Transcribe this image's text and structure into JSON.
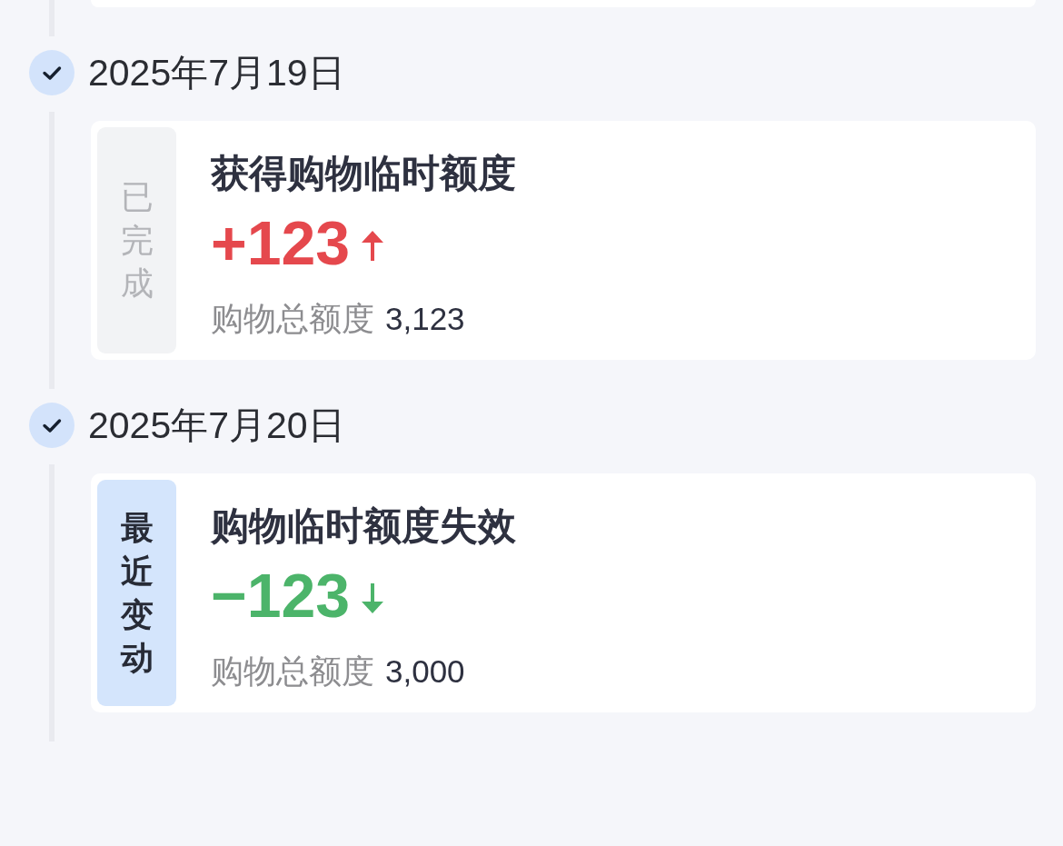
{
  "timeline": [
    {
      "date": "2025年7月19日",
      "checked": true,
      "tag": {
        "text": "已完成",
        "kind": "done"
      },
      "title": "获得购物临时额度",
      "amount": "+123",
      "increase": true,
      "total_label": "购物总额度",
      "total_value": "3,123"
    },
    {
      "date": "2025年7月20日",
      "checked": true,
      "tag": {
        "text": "最近变动",
        "kind": "recent"
      },
      "title": "购物临时额度失效",
      "amount": "−123",
      "increase": false,
      "total_label": "购物总额度",
      "total_value": "3,000"
    }
  ]
}
